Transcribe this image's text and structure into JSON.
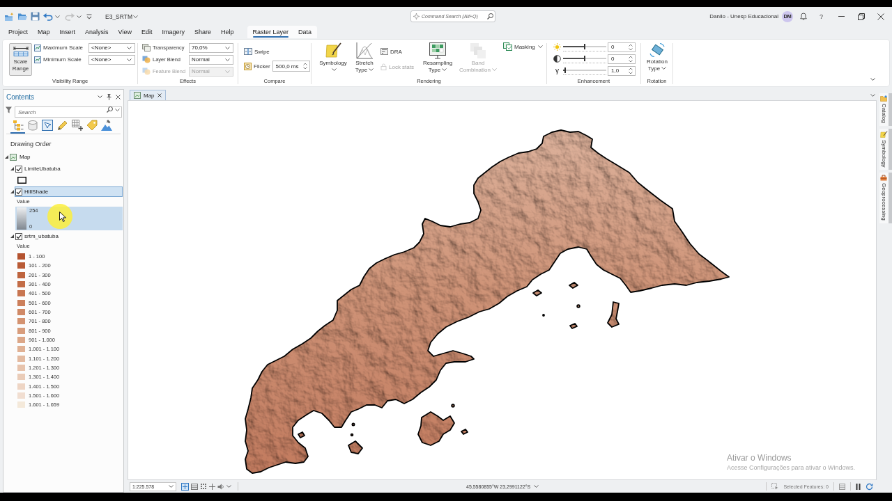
{
  "title_bar": {
    "quick_access": [
      {
        "kind": "new-project",
        "disabled": false
      },
      {
        "kind": "open",
        "disabled": false
      },
      {
        "kind": "save",
        "disabled": false
      },
      {
        "kind": "undo",
        "disabled": false
      },
      {
        "kind": "redo",
        "disabled": true
      },
      {
        "kind": "customize",
        "disabled": false
      }
    ],
    "project": "E3_SRTM",
    "command_search": {
      "placeholder": "Command Search (Alt+Q)"
    },
    "user": "Danilo - Unesp Educacional",
    "avatar": "DM",
    "help": "?"
  },
  "menu": {
    "tabs": [
      {
        "label": "Project",
        "selected": false
      },
      {
        "label": "Map",
        "selected": false
      },
      {
        "label": "Insert",
        "selected": false
      },
      {
        "label": "Analysis",
        "selected": false
      },
      {
        "label": "View",
        "selected": false
      },
      {
        "label": "Edit",
        "selected": false
      },
      {
        "label": "Imagery",
        "selected": false
      },
      {
        "label": "Share",
        "selected": false
      },
      {
        "label": "Help",
        "selected": false
      }
    ],
    "contextual_tabs": [
      {
        "label": "Raster Layer",
        "selected": true
      },
      {
        "label": "Data",
        "selected": false
      }
    ]
  },
  "ribbon": {
    "visibility_range": {
      "label": "Visibility Range",
      "scale_range": "Scale Range",
      "fields": [
        {
          "label": "Maximum Scale",
          "value": "<None>"
        },
        {
          "label": "Minimum Scale",
          "value": "<None>"
        }
      ]
    },
    "effects": {
      "label": "Effects",
      "fields": [
        {
          "kind": "transparency",
          "label": "Transparency",
          "value": "70,0%",
          "disabled": false
        },
        {
          "kind": "layer-blend",
          "label": "Layer Blend",
          "value": "Normal",
          "disabled": false
        },
        {
          "kind": "feature-blend",
          "label": "Feature Blend",
          "value": "Normal",
          "disabled": true
        }
      ]
    },
    "compare": {
      "label": "Compare",
      "swipe": "Swipe",
      "flicker": {
        "label": "Flicker",
        "value": "500,0 ms"
      }
    },
    "rendering": {
      "label": "Rendering",
      "buttons": [
        {
          "kind": "symbology",
          "label": "Symbology",
          "disabled": false
        },
        {
          "kind": "stretch",
          "label": "Stretch Type",
          "disabled": false
        },
        {
          "kind": "dra",
          "label": "DRA",
          "disabled": false
        },
        {
          "kind": "lock",
          "label": "Lock stats",
          "disabled": true
        },
        {
          "kind": "resampling",
          "label": "Resampling Type",
          "disabled": false
        },
        {
          "kind": "band",
          "label": "Band Combination",
          "disabled": true
        },
        {
          "kind": "masking",
          "label": "Masking",
          "disabled": false
        }
      ]
    },
    "enhancement": {
      "label": "Enhancement",
      "sliders": [
        {
          "kind": "brightness",
          "level": 0.5,
          "reading": "0"
        },
        {
          "kind": "contrast",
          "level": 0.5,
          "reading": "0"
        },
        {
          "kind": "gamma",
          "symbol": "γ",
          "level": 0.05,
          "reading": "1,0"
        }
      ]
    },
    "rotation": {
      "label": "Rotation",
      "button": "Rotation Type"
    }
  },
  "contents": {
    "title": "Contents",
    "search": {
      "placeholder": "Search"
    },
    "views": [
      {
        "kind": "drawing-order",
        "selected": true
      },
      {
        "kind": "data-source",
        "selected": false
      },
      {
        "kind": "selection",
        "selected": false
      },
      {
        "kind": "editing",
        "selected": false
      },
      {
        "kind": "snapping",
        "selected": false
      },
      {
        "kind": "labeling",
        "selected": false
      },
      {
        "kind": "perspective",
        "selected": false
      }
    ],
    "heading": "Drawing Order",
    "tree": [
      {
        "kind": "map",
        "label": "Map",
        "expanded": true,
        "selected": false,
        "children": [
          {
            "kind": "layer",
            "label": "LimiteUbatuba",
            "checked": true,
            "expanded": true,
            "selected": false,
            "legend": {
              "kind": "outline"
            }
          },
          {
            "kind": "layer",
            "label": "HillShade",
            "checked": true,
            "expanded": true,
            "selected": true,
            "legend": {
              "kind": "stretch",
              "heading": "Value",
              "high": "254",
              "low": "0",
              "highlighted": true
            }
          },
          {
            "kind": "layer",
            "label": "srtm_ubatuba",
            "checked": true,
            "expanded": true,
            "selected": false,
            "legend": {
              "kind": "classes",
              "heading": "Value",
              "classes": [
                {
                  "label": "1 - 100",
                  "color": "#b4532f"
                },
                {
                  "label": "101 - 200",
                  "color": "#b95b36"
                },
                {
                  "label": "201 - 300",
                  "color": "#be643e"
                },
                {
                  "label": "301 - 400",
                  "color": "#c36d47"
                },
                {
                  "label": "401 - 500",
                  "color": "#c87651"
                },
                {
                  "label": "501 - 600",
                  "color": "#cc7f5b"
                },
                {
                  "label": "601 - 700",
                  "color": "#d08966"
                },
                {
                  "label": "701 - 800",
                  "color": "#d49371"
                },
                {
                  "label": "801 - 900",
                  "color": "#d89d7c"
                },
                {
                  "label": "901 - 1.000",
                  "color": "#dca788"
                },
                {
                  "label": "1.001 - 1.100",
                  "color": "#e0b194"
                },
                {
                  "label": "1.101 - 1.200",
                  "color": "#e3baa0"
                },
                {
                  "label": "1.201 - 1.300",
                  "color": "#e7c3ac"
                },
                {
                  "label": "1.301 - 1.400",
                  "color": "#eaccb8"
                },
                {
                  "label": "1.401 - 1.500",
                  "color": "#eed5c4"
                },
                {
                  "label": "1.501 - 1.600",
                  "color": "#f1ded1"
                },
                {
                  "label": "1.601 - 1.659",
                  "color": "#f4e9da"
                }
              ]
            }
          }
        ]
      }
    ]
  },
  "map_view": {
    "tabs": [
      {
        "label": "Map",
        "selected": true
      }
    ],
    "scale": "1:225.578",
    "coordinates": "45,5580855°W 23,2991122°S",
    "selected_features": "Selected Features: 0"
  },
  "dock_tabs": [
    {
      "kind": "catalog",
      "label": "Catalog"
    },
    {
      "kind": "symbology",
      "label": "Symbology"
    },
    {
      "kind": "geoprocessing",
      "label": "Geoprocessing"
    }
  ],
  "activation_notice": {
    "title": "Ativar o Windows",
    "message": "Acesse Configurações para ativar o Windows."
  },
  "pointer": {
    "highlighted": true
  }
}
